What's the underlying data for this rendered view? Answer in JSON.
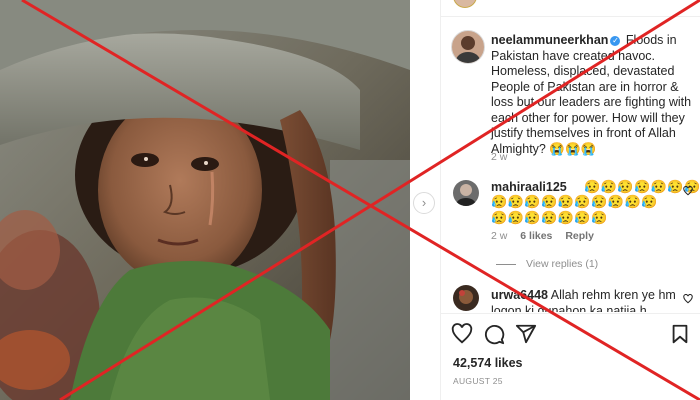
{
  "post": {
    "author": "neelammuneerkhan",
    "caption": "Floods in Pakistan have created havoc. Homeless, displaced, devastated People of Pakistan are in horror & loss but our leaders are fighting with each other for power. How will they justify themselves in front of Allah Almighty?",
    "caption_emoji": "😭😭😭",
    "age": "2 w",
    "likes": "42,574 likes",
    "date": "AUGUST 25"
  },
  "comments": [
    {
      "user": "mahiraali125",
      "emoji_line1": "😥😥😥😥😥😥😥",
      "emoji_line2": "😥😥😥😥😥😥😥😥😥😥😥😥😥😥😥😥😥",
      "age": "2 w",
      "likes": "6 likes",
      "reply": "Reply",
      "view_replies": "View replies (1)"
    },
    {
      "user": "urwa6448",
      "text": "Allah rehm kren ye hm",
      "text2": "logon ki gunahon ka natija h chud"
    }
  ],
  "icons": {
    "like": "heart-icon",
    "comment": "comment-icon",
    "share": "share-icon",
    "save": "bookmark-icon",
    "next": "chevron-right-icon"
  },
  "colors": {
    "cross": "#e02424",
    "verified": "#3897f0"
  }
}
